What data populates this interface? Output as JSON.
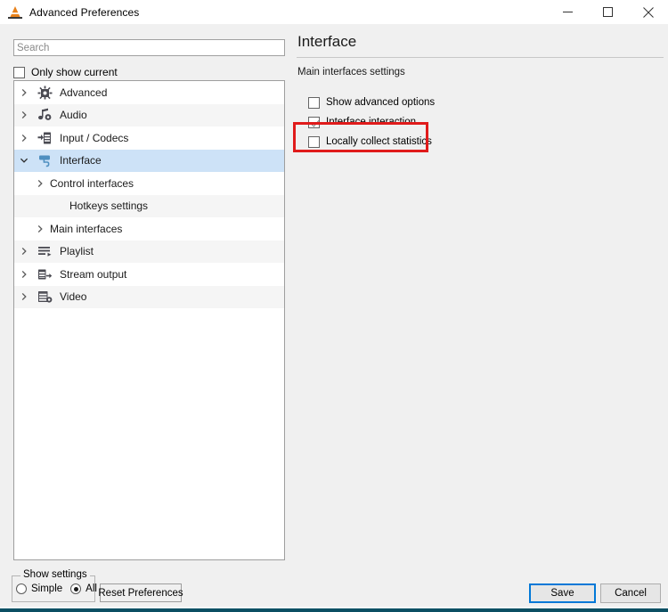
{
  "window": {
    "title": "Advanced Preferences",
    "icon": "vlc-cone-icon",
    "controls": {
      "minimize": "Minimize",
      "maximize": "Maximize",
      "close": "Close"
    }
  },
  "search": {
    "value": "",
    "placeholder": "Search"
  },
  "only_show_current": {
    "label": "Only show current",
    "checked": false
  },
  "tree": {
    "items": [
      {
        "label": "Advanced",
        "icon": "gear-chip-icon",
        "level": 0,
        "expander": "collapsed",
        "selected": false
      },
      {
        "label": "Audio",
        "icon": "music-note-icon",
        "level": 0,
        "expander": "collapsed",
        "selected": false
      },
      {
        "label": "Input / Codecs",
        "icon": "film-input-icon",
        "level": 0,
        "expander": "collapsed",
        "selected": false
      },
      {
        "label": "Interface",
        "icon": "paint-roller-icon",
        "level": 0,
        "expander": "expanded",
        "selected": true
      },
      {
        "label": "Control interfaces",
        "icon": "none",
        "level": 1,
        "expander": "collapsed",
        "selected": false
      },
      {
        "label": "Hotkeys settings",
        "icon": "none",
        "level": 1,
        "expander": "none",
        "selected": false
      },
      {
        "label": "Main interfaces",
        "icon": "none",
        "level": 1,
        "expander": "collapsed",
        "selected": false
      },
      {
        "label": "Playlist",
        "icon": "playlist-icon",
        "level": 0,
        "expander": "collapsed",
        "selected": false
      },
      {
        "label": "Stream output",
        "icon": "stream-out-icon",
        "level": 0,
        "expander": "collapsed",
        "selected": false
      },
      {
        "label": "Video",
        "icon": "video-icon",
        "level": 0,
        "expander": "collapsed",
        "selected": false
      }
    ]
  },
  "show_settings": {
    "legend": "Show settings",
    "simple_label": "Simple",
    "all_label": "All",
    "selected": "All"
  },
  "buttons": {
    "reset": "Reset Preferences",
    "save": "Save",
    "cancel": "Cancel"
  },
  "panel": {
    "title": "Interface",
    "subtitle": "Main interfaces settings",
    "options": [
      {
        "label": "Show advanced options",
        "checked": false
      },
      {
        "label": "Interface interaction",
        "checked": true
      },
      {
        "label": "Locally collect statistics",
        "checked": false
      }
    ]
  },
  "annotation": {
    "target": "Locally collect statistics",
    "color": "#e01b1b"
  },
  "colors": {
    "window_bg": "#f0f0f0",
    "selection": "#cde2f7",
    "row_alt": "#f5f5f5",
    "accent": "#0078d7",
    "annotation": "#e01b1b",
    "vlc_orange": "#e8821a"
  }
}
